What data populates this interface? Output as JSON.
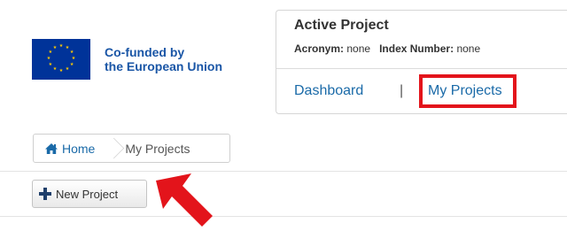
{
  "branding": {
    "line1": "Co-funded by",
    "line2": "the European Union",
    "flag_color": "#003399",
    "star_color": "#ffcc00"
  },
  "project_panel": {
    "title": "Active Project",
    "acronym_label": "Acronym:",
    "acronym_value": "none",
    "index_label": "Index Number:",
    "index_value": "none"
  },
  "nav": {
    "dashboard_label": "Dashboard",
    "separator": "|",
    "my_projects_label": "My Projects"
  },
  "breadcrumb": {
    "home_label": "Home",
    "current_label": "My Projects"
  },
  "toolbar": {
    "new_project_label": "New Project"
  },
  "colors": {
    "link": "#1a6aa8",
    "highlight": "#e3141b"
  },
  "icons": {
    "home": "home-icon",
    "plus": "plus-icon",
    "annotation": "red-arrow-icon"
  }
}
